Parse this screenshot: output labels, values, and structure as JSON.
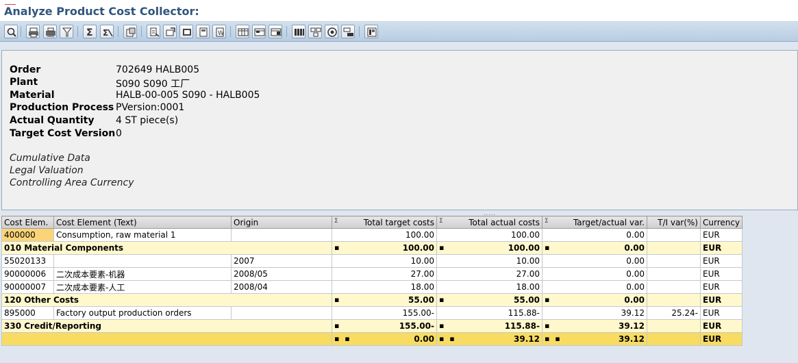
{
  "window": {
    "title": "Analyze Product Cost Collector:"
  },
  "toolbar": {
    "buttons": [
      {
        "name": "details-icon"
      },
      {
        "name": "print-icon"
      },
      {
        "name": "print-preview-icon"
      },
      {
        "name": "filter-icon"
      },
      {
        "name": "sum-icon"
      },
      {
        "name": "subtotal-icon"
      },
      {
        "name": "graphics-icon"
      },
      {
        "name": "export-icon"
      },
      {
        "name": "send-icon"
      },
      {
        "name": "mail-icon"
      },
      {
        "name": "local-file-icon"
      },
      {
        "name": "word-processing-icon"
      },
      {
        "name": "change-layout-icon"
      },
      {
        "name": "select-layout-icon"
      },
      {
        "name": "save-layout-icon"
      },
      {
        "name": "columns-icon"
      },
      {
        "name": "cost-display-icon"
      },
      {
        "name": "drilldown-icon"
      },
      {
        "name": "settings-icon"
      },
      {
        "name": "info-icon"
      }
    ]
  },
  "header": {
    "fields": [
      {
        "label": "Order",
        "value": "702649 HALB005"
      },
      {
        "label": "Plant",
        "value": "S090 S090 工厂"
      },
      {
        "label": "Material",
        "value": "HALB-00-005 S090 - HALB005"
      },
      {
        "label": "Production Process",
        "value": "PVersion:0001"
      },
      {
        "label": "Actual Quantity",
        "value": "4 ST piece(s)"
      },
      {
        "label": "Target Cost Version",
        "value": "0"
      }
    ],
    "notes": [
      "Cumulative Data",
      "Legal Valuation",
      "Controlling Area Currency"
    ]
  },
  "splitter": {
    "dots": "....."
  },
  "grid": {
    "columns": [
      "Cost Elem.",
      "Cost Element (Text)",
      "Origin",
      "Total target costs",
      "Total actual costs",
      "Target/actual var.",
      "T/I var(%)",
      "Currency"
    ],
    "rows": [
      {
        "type": "item",
        "cost_elem": "400000",
        "text": "Consumption, raw material 1",
        "origin": "",
        "target": "100.00",
        "actual": "100.00",
        "var": "0.00",
        "pct": "",
        "cur": "EUR",
        "selected": true
      },
      {
        "type": "sub",
        "cost_elem": "010 Material Components",
        "target_mk": "▪",
        "target": "100.00",
        "actual_mk": "▪",
        "actual": "100.00",
        "var_mk": "▪",
        "var": "0.00",
        "cur": "EUR"
      },
      {
        "type": "item",
        "cost_elem": "55020133",
        "text": "",
        "origin": "2007",
        "target": "10.00",
        "actual": "10.00",
        "var": "0.00",
        "pct": "",
        "cur": "EUR"
      },
      {
        "type": "item",
        "cost_elem": "90000006",
        "text": "二次成本要素-机器",
        "origin": "2008/05",
        "target": "27.00",
        "actual": "27.00",
        "var": "0.00",
        "pct": "",
        "cur": "EUR"
      },
      {
        "type": "item",
        "cost_elem": "90000007",
        "text": "二次成本要素-人工",
        "origin": "2008/04",
        "target": "18.00",
        "actual": "18.00",
        "var": "0.00",
        "pct": "",
        "cur": "EUR"
      },
      {
        "type": "sub",
        "cost_elem": "120 Other Costs",
        "target_mk": "▪",
        "target": "55.00",
        "actual_mk": "▪",
        "actual": "55.00",
        "var_mk": "▪",
        "var": "0.00",
        "cur": "EUR"
      },
      {
        "type": "item",
        "cost_elem": "895000",
        "text": "Factory output production orders",
        "origin": "",
        "target": "155.00-",
        "actual": "115.88-",
        "var": "39.12",
        "pct": "25.24-",
        "cur": "EUR"
      },
      {
        "type": "sub",
        "cost_elem": "330 Credit/Reporting",
        "target_mk": "▪",
        "target": "155.00-",
        "actual_mk": "▪",
        "actual": "115.88-",
        "var_mk": "▪",
        "var": "39.12",
        "cur": "EUR"
      },
      {
        "type": "tot",
        "cost_elem": "",
        "target_mk": "▪ ▪",
        "target": "0.00",
        "actual_mk": "▪ ▪",
        "actual": "39.12",
        "var_mk": "▪ ▪",
        "var": "39.12",
        "cur": "EUR"
      }
    ]
  },
  "colors": {
    "title": "#30557e",
    "subtotal_row": "#fff8cc",
    "total_row": "#f8dc62",
    "selected_cell": "#fbd47a"
  }
}
